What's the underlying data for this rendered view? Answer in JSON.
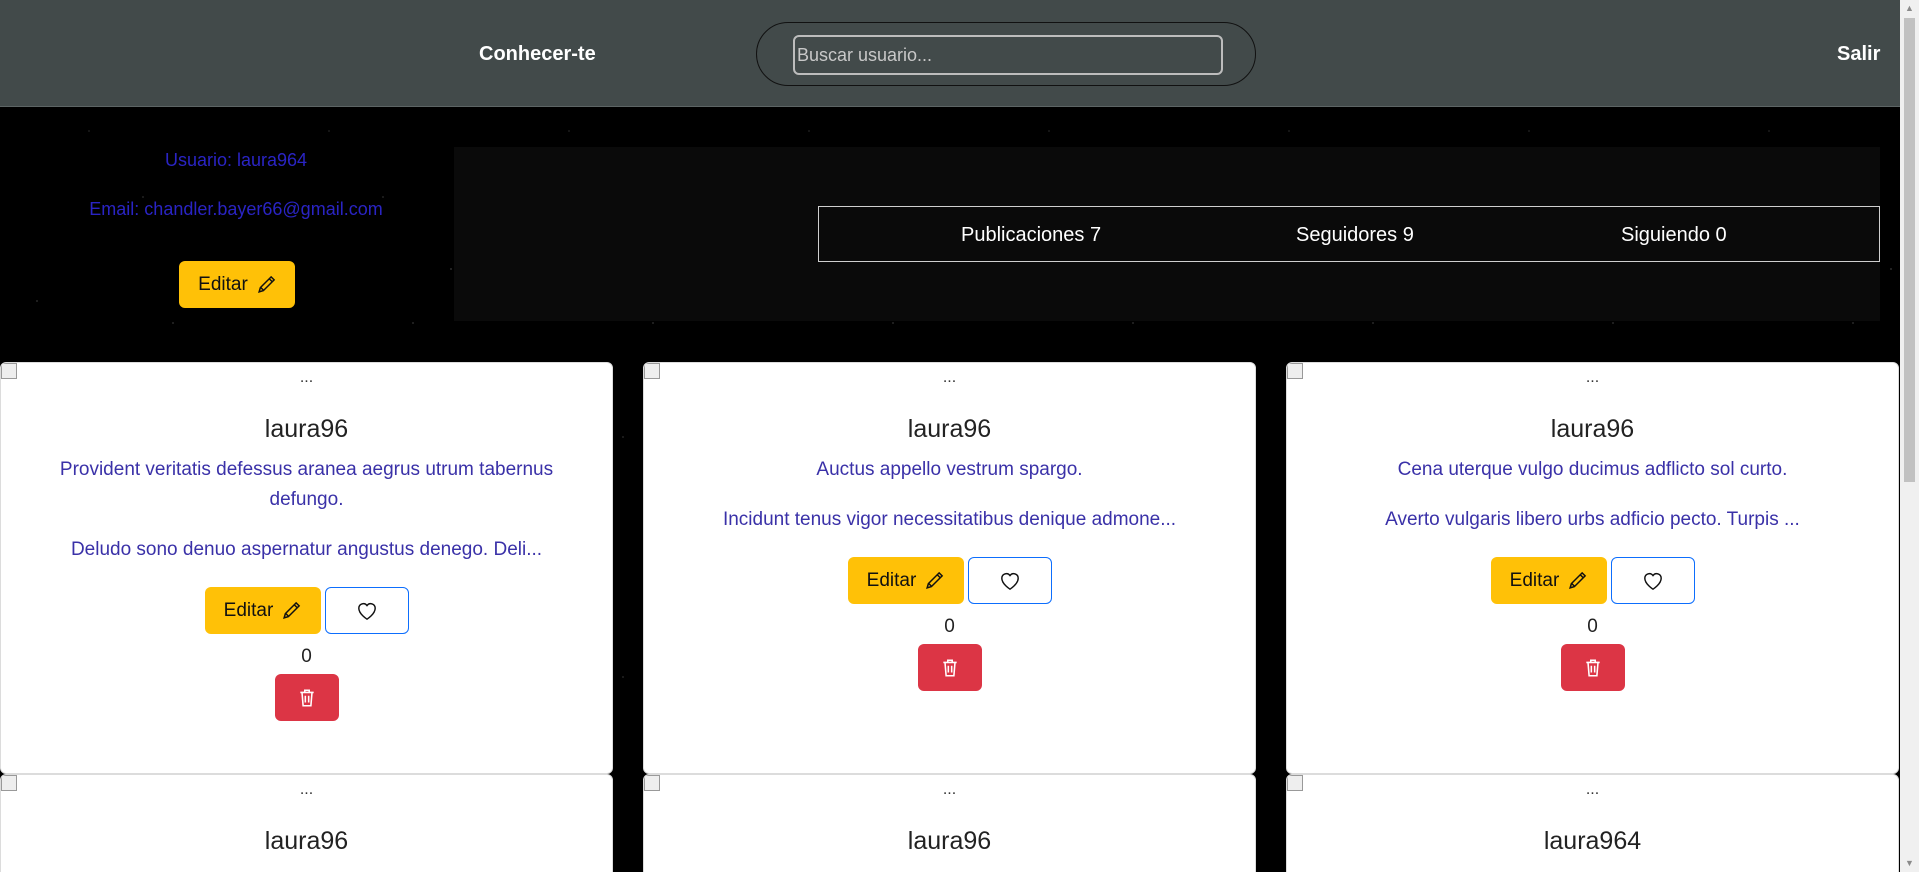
{
  "navbar": {
    "brand": "Conhecer-te",
    "search_placeholder": "Buscar usuario...",
    "logout": "Salir"
  },
  "profile": {
    "user_line": "Usuario: laura964",
    "email_line": "Email: chandler.bayer66@gmail.com",
    "edit_label": "Editar"
  },
  "stats": {
    "posts": "Publicaciones 7",
    "followers": "Seguidores 9",
    "following": "Siguiendo 0"
  },
  "colors": {
    "navbar": "#424a4a",
    "edit_button": "#ffc107",
    "delete_button": "#dc3545",
    "like_border": "#0d6efd",
    "link_text": "#2a24c4"
  },
  "posts": [
    {
      "image_alt": "...",
      "author": "laura96",
      "title": "Provident veritatis defessus aranea aegrus utrum tabernus defungo.",
      "body": "Deludo sono denuo aspernatur angustus denego. Deli...",
      "edit_label": "Editar",
      "likes": "0"
    },
    {
      "image_alt": "...",
      "author": "laura96",
      "title": "Auctus appello vestrum spargo.",
      "body": "Incidunt tenus vigor necessitatibus denique admone...",
      "edit_label": "Editar",
      "likes": "0"
    },
    {
      "image_alt": "...",
      "author": "laura96",
      "title": "Cena uterque vulgo ducimus adflicto sol curto.",
      "body": "Averto vulgaris libero urbs adficio pecto. Turpis ...",
      "edit_label": "Editar",
      "likes": "0"
    },
    {
      "image_alt": "...",
      "author": "laura96"
    },
    {
      "image_alt": "...",
      "author": "laura96"
    },
    {
      "image_alt": "...",
      "author": "laura964"
    }
  ]
}
